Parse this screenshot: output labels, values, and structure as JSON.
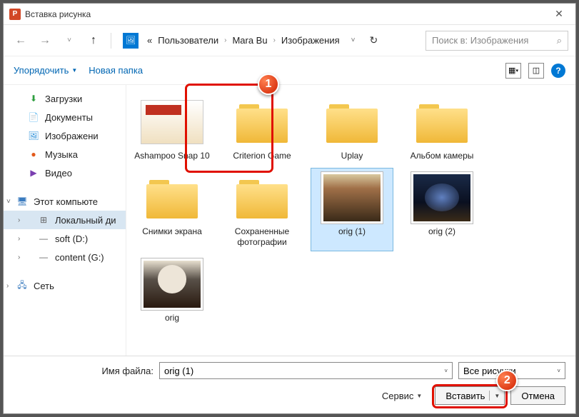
{
  "title": "Вставка рисунка",
  "app_badge": "P",
  "nav": {
    "back": "←",
    "fwd": "→",
    "up": "↑",
    "refresh": "↻",
    "drop": "˅"
  },
  "breadcrumb": {
    "prefix": "«",
    "items": [
      "Пользователи",
      "Mara Bu",
      "Изображения"
    ]
  },
  "search": {
    "placeholder": "Поиск в: Изображения",
    "icon": "⌕"
  },
  "toolbar": {
    "organize": "Упорядочить",
    "new_folder": "Новая папка",
    "help": "?"
  },
  "sidebar": {
    "quick": [
      {
        "icon": "⬇",
        "color": "#2e9e3f",
        "label": "Загрузки"
      },
      {
        "icon": "📄",
        "color": "#2a6fc9",
        "label": "Документы"
      },
      {
        "icon": "🖼",
        "color": "#2a8fd9",
        "label": "Изображени"
      },
      {
        "icon": "●",
        "color": "#e25a1b",
        "label": "Музыка"
      },
      {
        "icon": "▶",
        "color": "#7a3fb0",
        "label": "Видео"
      }
    ],
    "pc": {
      "label": "Этот компьюте",
      "icon": "🖥"
    },
    "drives": [
      {
        "icon": "⊞",
        "label": "Локальный ди",
        "sel": true
      },
      {
        "icon": "—",
        "label": "soft (D:)"
      },
      {
        "icon": "—",
        "label": "content (G:)"
      }
    ],
    "network": {
      "icon": "🖧",
      "label": "Сеть"
    }
  },
  "files": [
    {
      "type": "app",
      "label": "Ashampoo Snap 10"
    },
    {
      "type": "folder",
      "label": "Criterion Game"
    },
    {
      "type": "folder",
      "label": "Uplay"
    },
    {
      "type": "folder",
      "label": "Альбом камеры"
    },
    {
      "type": "folder",
      "label": "Снимки экрана"
    },
    {
      "type": "folder",
      "label": "Сохраненные фотографии"
    },
    {
      "type": "img",
      "cls": "cat1",
      "label": "orig (1)",
      "sel": true
    },
    {
      "type": "img",
      "cls": "cat2",
      "label": "orig (2)"
    },
    {
      "type": "img",
      "cls": "cat3",
      "label": "orig"
    }
  ],
  "footer": {
    "filename_label": "Имя файла:",
    "filename_value": "orig (1)",
    "filter": "Все рисунки",
    "service": "Сервис",
    "insert": "Вставить",
    "cancel": "Отмена"
  },
  "callouts": {
    "one": "1",
    "two": "2"
  }
}
